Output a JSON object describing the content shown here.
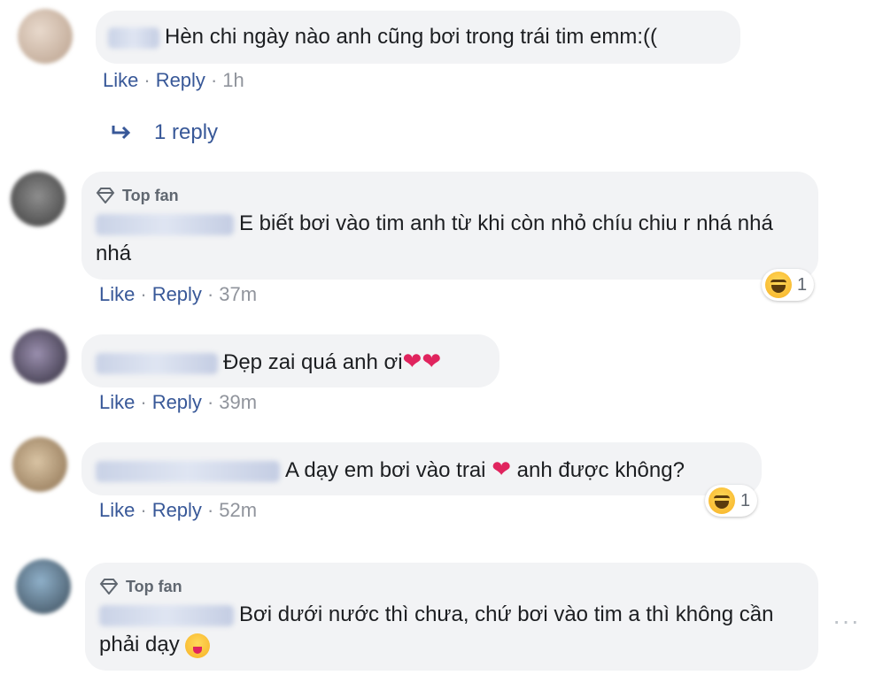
{
  "comments": [
    {
      "top_fan": "",
      "text": "Hèn chi ngày nào anh cũng bơi trong trái tim emm:((",
      "like": "Like",
      "reply": "Reply",
      "time": "1h",
      "reaction_count": ""
    },
    {
      "top_fan": "Top fan",
      "text": "E biết bơi vào tim anh từ khi còn nhỏ chíu chiu r nhá nhá nhá",
      "like": "Like",
      "reply": "Reply",
      "time": "37m",
      "reaction_count": "1"
    },
    {
      "top_fan": "",
      "text": "Đẹp zai quá anh ơi",
      "like": "Like",
      "reply": "Reply",
      "time": "39m",
      "reaction_count": ""
    },
    {
      "top_fan": "",
      "text_before": "A dạy em bơi vào trai",
      "text_after": "anh được không?",
      "like": "Like",
      "reply": "Reply",
      "time": "52m",
      "reaction_count": "1"
    },
    {
      "top_fan": "Top fan",
      "text": "Bơi dưới nước thì chưa, chứ bơi vào tim a thì không cần phải dạy",
      "like": "",
      "reply": "",
      "time": "",
      "reaction_count": ""
    }
  ],
  "replies_link": "1 reply",
  "more_options": "···",
  "colors": {
    "bubble": "#f2f3f5",
    "link": "#385898",
    "meta": "#90949c"
  }
}
